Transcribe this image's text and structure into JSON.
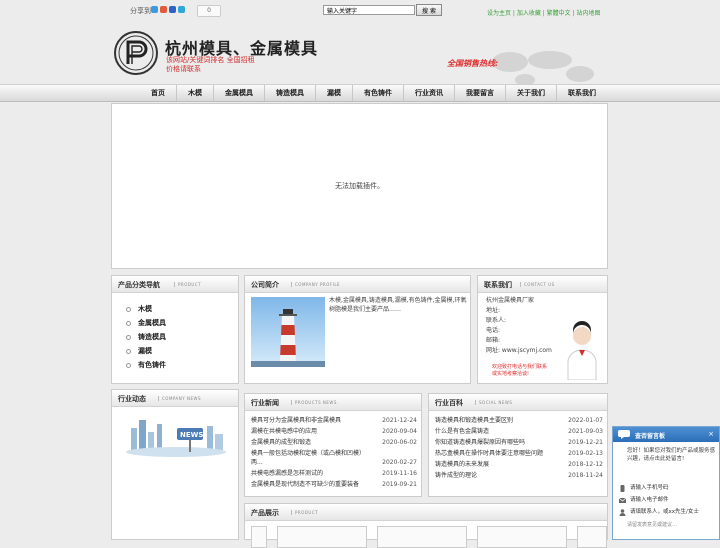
{
  "topbar": {
    "share_label": "分享到",
    "share_count": "0",
    "search_placeholder": "输入关键字",
    "search_button": "搜 索",
    "links": "设为主页 | 加入收藏 | 繁體中文 | 站内地图",
    "share_icons": [
      {
        "name": "qzone-icon",
        "color": "#3c9be0"
      },
      {
        "name": "weibo-icon",
        "color": "#e05a3c"
      },
      {
        "name": "baidu-icon",
        "color": "#2d62c6"
      },
      {
        "name": "tqq-icon",
        "color": "#2ea8d8"
      }
    ]
  },
  "header": {
    "title": "杭州模具、金属模具",
    "slogan_line1": "该网站/关键词排名  全国招租",
    "slogan_line2": "价格请联系",
    "hotline": "全国销售热线:"
  },
  "nav": {
    "items": [
      "首页",
      "木模",
      "金属模具",
      "铸造模具",
      "漏模",
      "有色铸件",
      "行业资讯",
      "我要留言",
      "关于我们",
      "联系我们"
    ]
  },
  "banner": {
    "message": "无法加载插件。"
  },
  "categories": {
    "title": "产品分类导航",
    "subtitle": "PRODUCT",
    "items": [
      "木模",
      "金属模具",
      "铸造模具",
      "漏模",
      "有色铸件"
    ]
  },
  "profile": {
    "title": "公司简介",
    "subtitle": "COMPANY PROFILE",
    "text": "木模,金属模具,铸造模具,漏模,有色铸件,金属模,环氧树脂模是我们主要产品……"
  },
  "contact": {
    "title": "联系我们",
    "subtitle": "CONTACT US",
    "lines": [
      "杭州金属模具厂家",
      "地址:",
      "联系人:",
      "电话:",
      "邮箱:",
      "网址: www.jscymj.com"
    ],
    "cta_line1": "欢迎致打电话与我们联系",
    "cta_line2": "或实地考察洽谈!"
  },
  "company_news": {
    "title": "行业动态",
    "subtitle": "COMPANY NEWS",
    "sign_text": "NEWS"
  },
  "industry_news": {
    "title": "行业新闻",
    "subtitle": "PRODUCTS NEWS",
    "items": [
      {
        "title": "模具可分为金属模具和非金属模具",
        "date": "2021-12-24"
      },
      {
        "title": "漏模在共模电感中的应用",
        "date": "2020-09-04"
      },
      {
        "title": "金属模具的成型和锻造",
        "date": "2020-06-02"
      },
      {
        "title": "模具一般包括动模和定模（或凸模和凹模）两...",
        "date": "2020-02-27"
      },
      {
        "title": "共模电感漏感是怎样测试的",
        "date": "2019-11-16"
      },
      {
        "title": "金属模具是现代制造不可缺少的重要装备",
        "date": "2019-09-21"
      }
    ]
  },
  "industry_wiki": {
    "title": "行业百科",
    "subtitle": "SOCIAL NEWS",
    "items": [
      {
        "title": "铸造模具和锻造模具主要区别",
        "date": "2022-01-07"
      },
      {
        "title": "什么是有色金属铸造",
        "date": "2021-09-03"
      },
      {
        "title": "你知道铸造模具爆裂原因有哪些吗",
        "date": "2019-12-21"
      },
      {
        "title": "热芯盒模具在操作时具体要注意哪些问题",
        "date": "2019-02-13"
      },
      {
        "title": "铸造模具的未来发展",
        "date": "2018-12-12"
      },
      {
        "title": "铸件成型的理论",
        "date": "2018-11-24"
      }
    ]
  },
  "products": {
    "title": "产品展示",
    "subtitle": "PRODUCT"
  },
  "chat": {
    "title": "查否留言板",
    "greeting": "您好！如果您对我们的产品或服务感兴趣，请点击此处留言!",
    "phone_placeholder": "请输入手机号码",
    "email_placeholder": "请输入电子邮件",
    "name_placeholder": "请填联系人，或xx先生/女士",
    "message_placeholder": "请留发表意见或建议…"
  },
  "colors": {
    "accent_red": "#e03030",
    "link_green": "#39a039",
    "chat_blue": "#2c6fb8"
  }
}
